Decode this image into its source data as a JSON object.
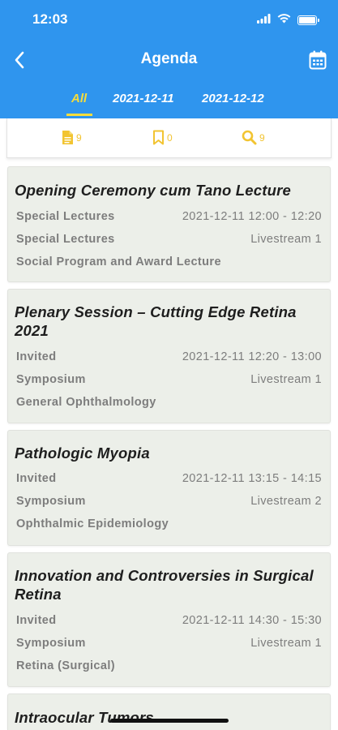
{
  "status_bar": {
    "time": "12:03"
  },
  "header": {
    "title": "Agenda",
    "back_icon": "chevron-left-icon",
    "calendar_icon": "calendar-icon",
    "background_color": "#2f95ee"
  },
  "tabs": [
    {
      "label": "All",
      "active": true
    },
    {
      "label": "2021-12-11",
      "active": false
    },
    {
      "label": "2021-12-12",
      "active": false
    }
  ],
  "counts": {
    "documents": {
      "icon": "document-icon",
      "value": "9"
    },
    "bookmarks": {
      "icon": "bookmark-icon",
      "value": "0"
    },
    "search": {
      "icon": "search-icon",
      "value": "9"
    },
    "accent_color": "#f2c431"
  },
  "sessions": [
    {
      "title": "Opening Ceremony cum Tano Lecture",
      "type": "Special Lectures",
      "datetime": "2021-12-11 12:00 - 12:20",
      "category": "Special Lectures",
      "venue": "Livestream 1",
      "topic": "Social Program and Award Lecture"
    },
    {
      "title": "Plenary Session – Cutting Edge Retina 2021",
      "type": "Invited",
      "datetime": "2021-12-11 12:20 - 13:00",
      "category": "Symposium",
      "venue": "Livestream 1",
      "topic": "General Ophthalmology"
    },
    {
      "title": "Pathologic Myopia",
      "type": "Invited",
      "datetime": "2021-12-11 13:15 - 14:15",
      "category": "Symposium",
      "venue": "Livestream 2",
      "topic": "Ophthalmic Epidemiology"
    },
    {
      "title": "Innovation and Controversies in Surgical Retina",
      "type": "Invited",
      "datetime": "2021-12-11 14:30 - 15:30",
      "category": "Symposium",
      "venue": "Livestream 1",
      "topic": "Retina (Surgical)"
    },
    {
      "title": "Intraocular Tumors"
    }
  ]
}
